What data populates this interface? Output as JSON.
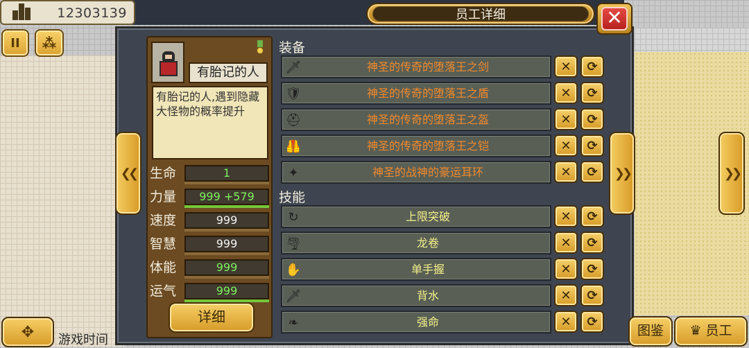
{
  "window": {
    "title": "员工详细",
    "close_label": "✕"
  },
  "hud": {
    "money": "12303139",
    "pause_label": "II",
    "game_time_label": "游戏时间"
  },
  "employee": {
    "name": "有胎记的人",
    "description": "有胎记的人,遇到隐藏大怪物的概率提升",
    "stats": [
      {
        "label": "生命",
        "value": "1",
        "color": "green",
        "bar": 0.0
      },
      {
        "label": "力量",
        "value": "999 +579",
        "color": "green",
        "bar": 1.0
      },
      {
        "label": "速度",
        "value": "999",
        "color": "white",
        "bar": 0.0
      },
      {
        "label": "智慧",
        "value": "999",
        "color": "white",
        "bar": 0.0
      },
      {
        "label": "体能",
        "value": "999",
        "color": "green",
        "bar": 0.0
      },
      {
        "label": "运气",
        "value": "999",
        "color": "green",
        "bar": 1.0
      }
    ],
    "detail_button": "详细"
  },
  "sections": {
    "equipment_title": "装备",
    "skills_title": "技能"
  },
  "equipment": [
    {
      "icon": "sword-icon",
      "glyph": "🗡",
      "name": "神圣的传奇的堕落王之剑"
    },
    {
      "icon": "shield-icon",
      "glyph": "🛡",
      "name": "神圣的传奇的堕落王之盾"
    },
    {
      "icon": "helmet-icon",
      "glyph": "⛑",
      "name": "神圣的传奇的堕落王之盔"
    },
    {
      "icon": "armor-icon",
      "glyph": "🦺",
      "name": "神圣的传奇的堕落王之铠"
    },
    {
      "icon": "earring-icon",
      "glyph": "✦",
      "name": "神圣的战神的豪运耳环"
    }
  ],
  "skills": [
    {
      "icon": "breakthrough-icon",
      "glyph": "↻",
      "name": "上限突破"
    },
    {
      "icon": "tornado-icon",
      "glyph": "🌪",
      "name": "龙卷"
    },
    {
      "icon": "one-hand-icon",
      "glyph": "✋",
      "name": "单手握"
    },
    {
      "icon": "blade-icon",
      "glyph": "🗡",
      "name": "背水"
    },
    {
      "icon": "wing-icon",
      "glyph": "❧",
      "name": "强命"
    }
  ],
  "actions": {
    "remove_glyph": "✕",
    "swap_glyph": "⟳"
  },
  "bottom_tabs": {
    "encyclopedia": "图鉴",
    "staff": "员工"
  }
}
